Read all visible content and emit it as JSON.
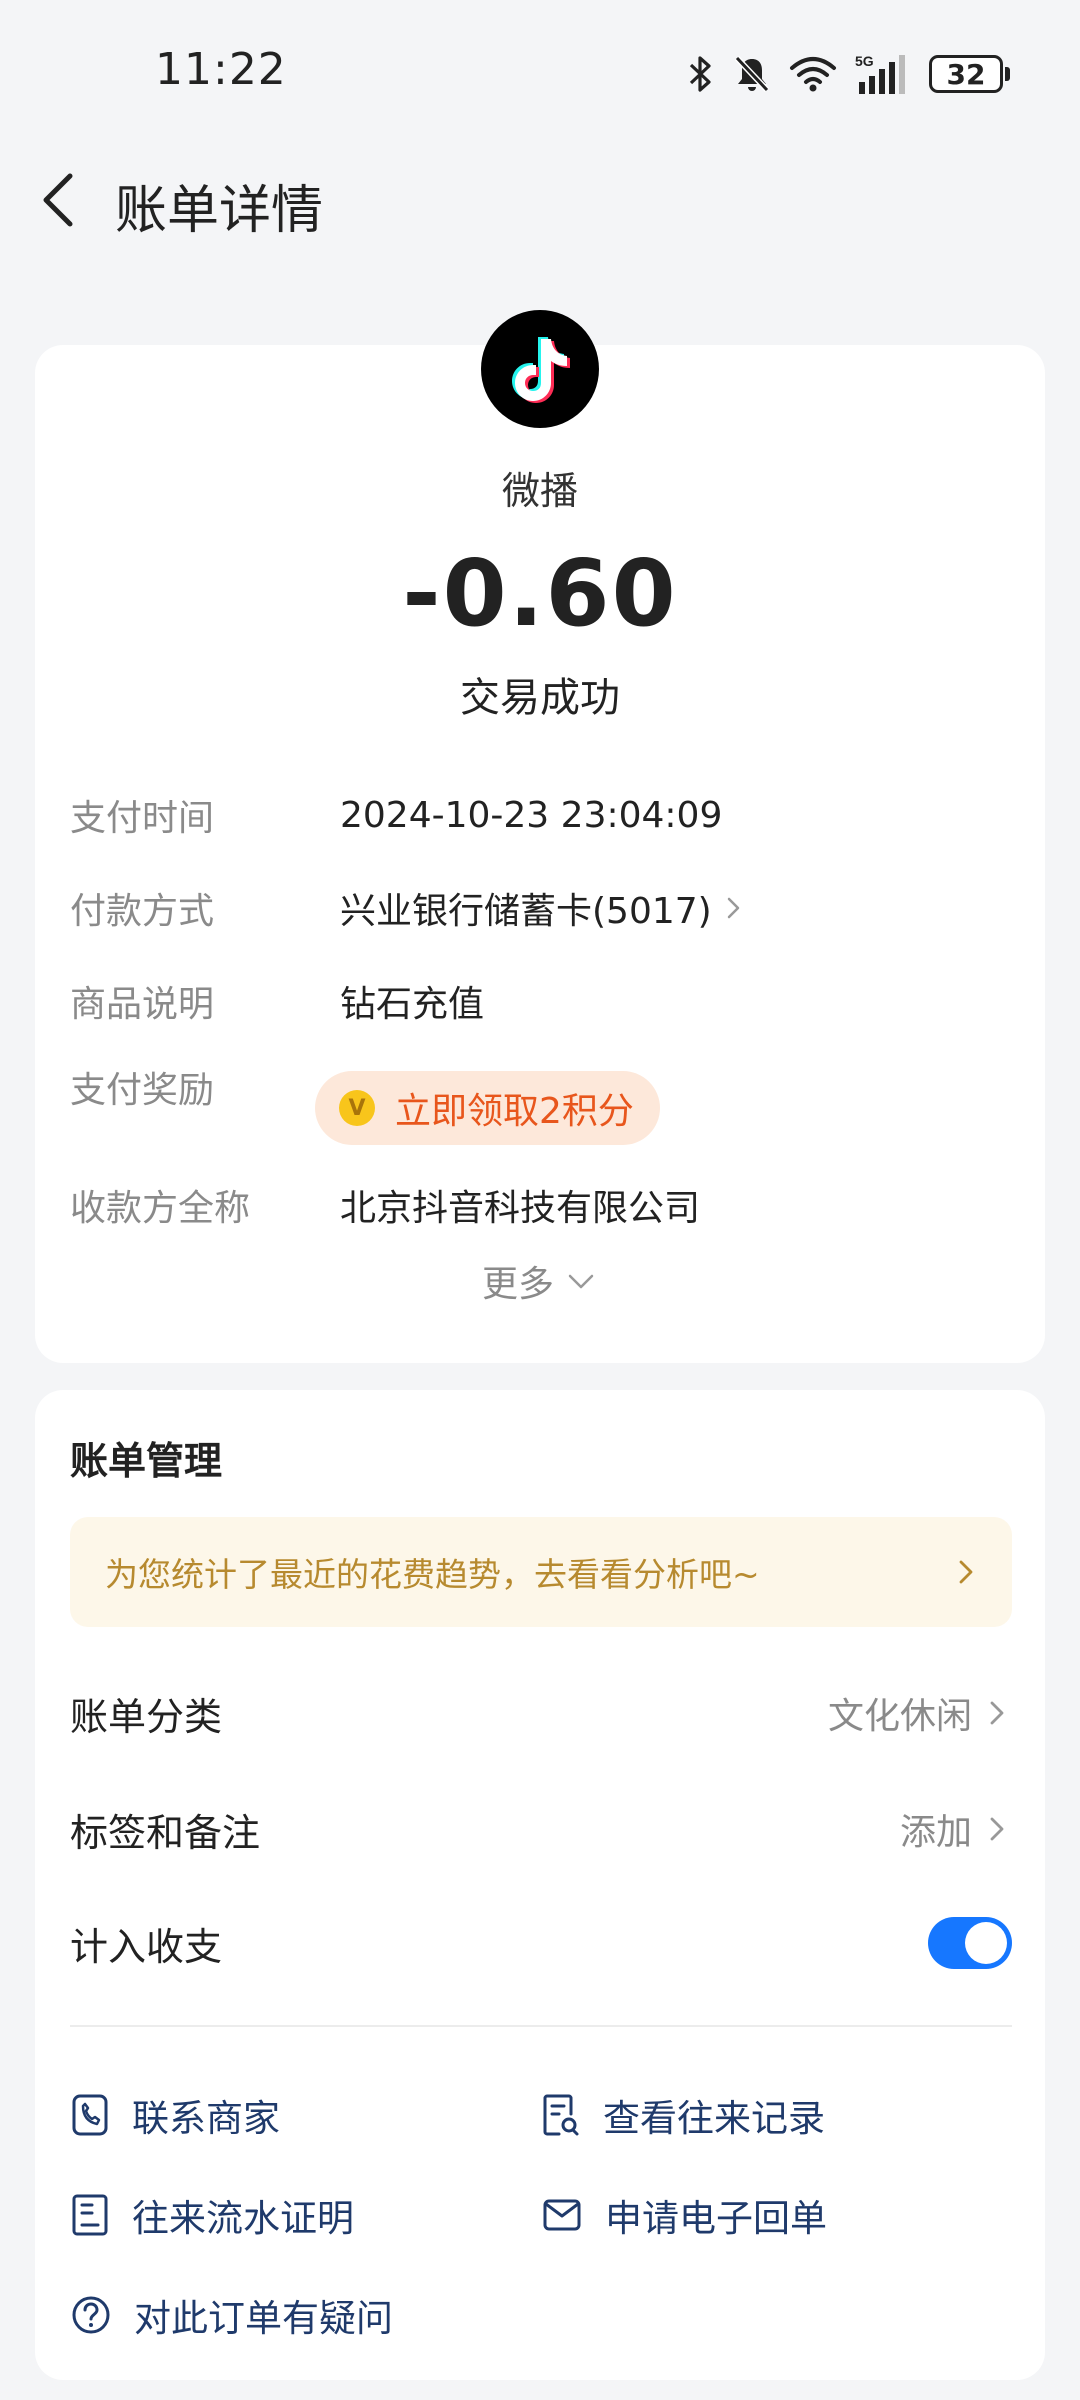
{
  "status_bar": {
    "time": "11:22",
    "network": "5G",
    "battery": "32"
  },
  "nav": {
    "title": "账单详情"
  },
  "transaction": {
    "merchant_logo_icon": "tiktok-icon",
    "merchant_name": "微播",
    "amount": "-0.60",
    "status": "交易成功",
    "details": [
      {
        "label": "支付时间",
        "value": "2024-10-23 23:04:09"
      },
      {
        "label": "付款方式",
        "value": "兴业银行储蓄卡(5017)"
      },
      {
        "label": "商品说明",
        "value": "钻石充值"
      },
      {
        "label": "支付奖励",
        "value": "立即领取2积分"
      },
      {
        "label": "收款方全称",
        "value": "北京抖音科技有限公司"
      }
    ],
    "more_label": "更多"
  },
  "bill_management": {
    "title": "账单管理",
    "tip": "为您统计了最近的花费趋势，去看看分析吧~",
    "category_label": "账单分类",
    "category_value": "文化休闲",
    "tags_label": "标签和备注",
    "tags_value": "添加",
    "include_label": "计入收支",
    "include_enabled": true,
    "actions": [
      {
        "label": "联系商家",
        "icon": "phone-icon"
      },
      {
        "label": "查看往来记录",
        "icon": "search-document-icon"
      },
      {
        "label": "往来流水证明",
        "icon": "document-icon"
      },
      {
        "label": "申请电子回单",
        "icon": "mail-icon"
      },
      {
        "label": "对此订单有疑问",
        "icon": "question-icon"
      }
    ]
  },
  "colors": {
    "accent_blue": "#1677ff",
    "reward_orange": "#e8561c",
    "tip_gold": "#b78a2f",
    "action_navy": "#1f3a6b"
  }
}
